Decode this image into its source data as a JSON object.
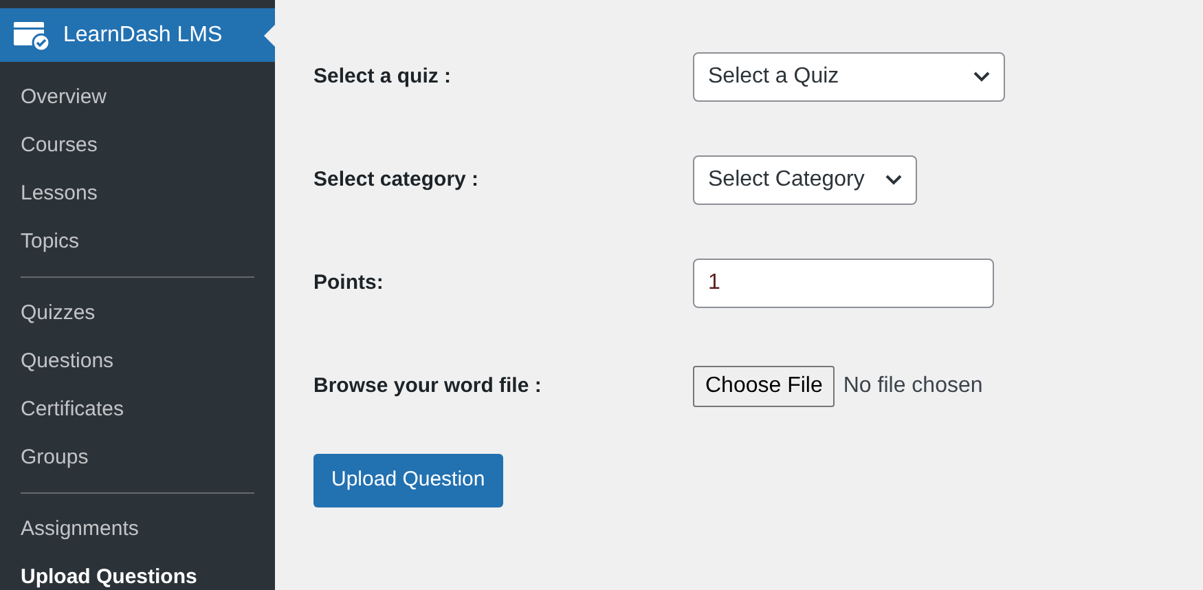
{
  "sidebar": {
    "header": {
      "title": "LearnDash LMS"
    },
    "groups": [
      [
        {
          "label": "Overview",
          "selected": false
        },
        {
          "label": "Courses",
          "selected": false
        },
        {
          "label": "Lessons",
          "selected": false
        },
        {
          "label": "Topics",
          "selected": false
        }
      ],
      [
        {
          "label": "Quizzes",
          "selected": false
        },
        {
          "label": "Questions",
          "selected": false
        },
        {
          "label": "Certificates",
          "selected": false
        },
        {
          "label": "Groups",
          "selected": false
        }
      ],
      [
        {
          "label": "Assignments",
          "selected": false
        },
        {
          "label": "Upload Questions",
          "selected": true
        }
      ]
    ]
  },
  "form": {
    "fields": [
      {
        "kind": "select",
        "label": "Select a quiz :",
        "value": "Select a Quiz",
        "wide": true
      },
      {
        "kind": "select",
        "label": "Select category :",
        "value": "Select Category",
        "wide": false
      },
      {
        "kind": "text",
        "label": "Points:",
        "value": "1"
      },
      {
        "kind": "file",
        "label": "Browse your word file :",
        "button": "Choose File",
        "status": "No file chosen"
      }
    ],
    "submit": "Upload Question"
  }
}
